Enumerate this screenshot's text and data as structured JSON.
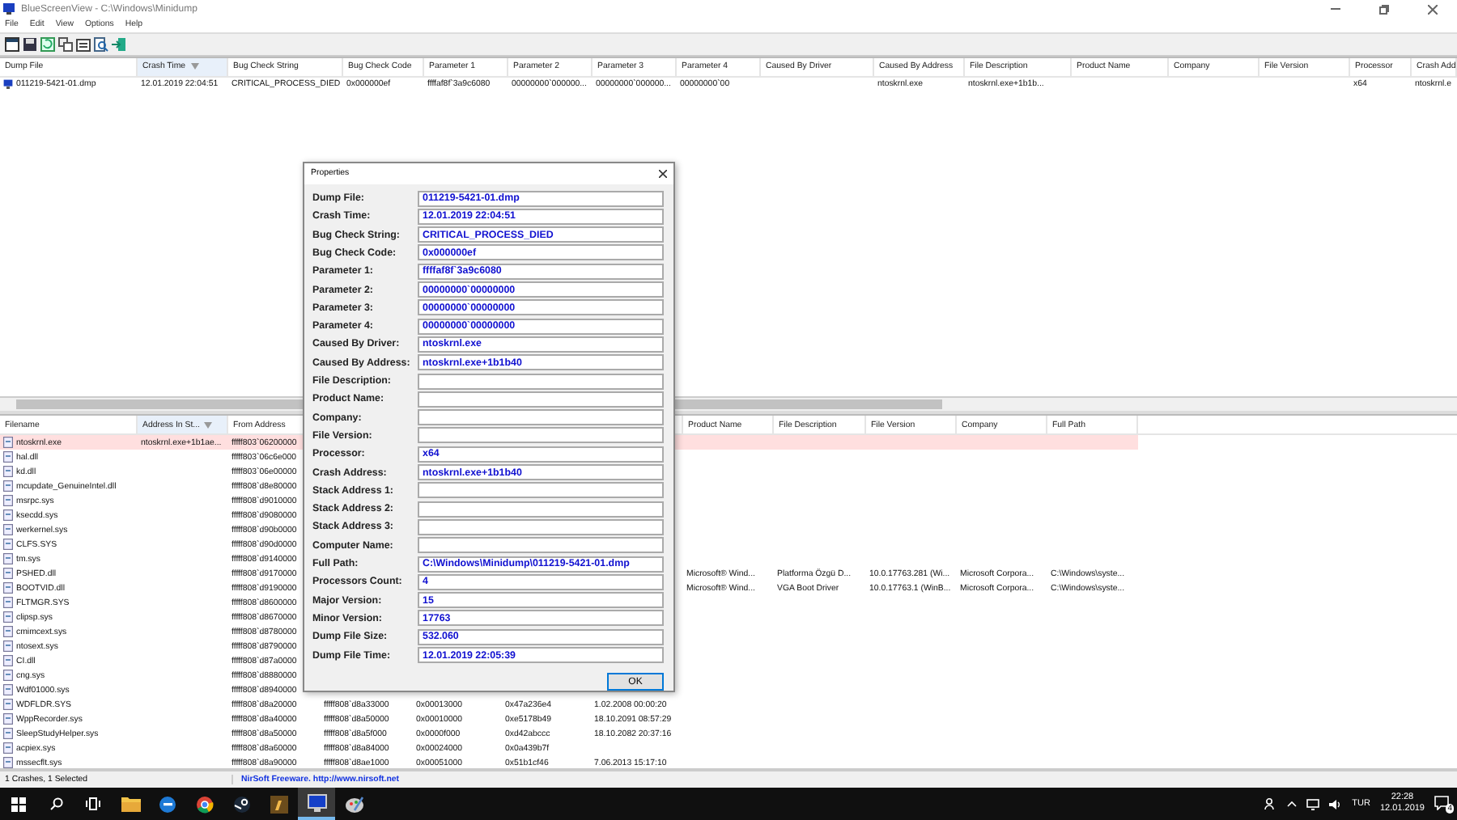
{
  "window": {
    "title": "BlueScreenView  -  C:\\Windows\\Minidump"
  },
  "menu": [
    "File",
    "Edit",
    "View",
    "Options",
    "Help"
  ],
  "dump_table": {
    "columns": [
      {
        "label": "Dump File",
        "sorted": false
      },
      {
        "label": "Crash Time",
        "sorted": true
      },
      {
        "label": "Bug Check String",
        "sorted": false
      },
      {
        "label": "Bug Check Code",
        "sorted": false
      },
      {
        "label": "Parameter 1",
        "sorted": false
      },
      {
        "label": "Parameter 2",
        "sorted": false
      },
      {
        "label": "Parameter 3",
        "sorted": false
      },
      {
        "label": "Parameter 4",
        "sorted": false
      },
      {
        "label": "Caused By Driver",
        "sorted": false
      },
      {
        "label": "Caused By Address",
        "sorted": false
      },
      {
        "label": "File Description",
        "sorted": false
      },
      {
        "label": "Product Name",
        "sorted": false
      },
      {
        "label": "Company",
        "sorted": false
      },
      {
        "label": "File Version",
        "sorted": false
      },
      {
        "label": "Processor",
        "sorted": false
      },
      {
        "label": "Crash Add",
        "sorted": false
      }
    ],
    "rows": [
      {
        "cells": [
          "011219-5421-01.dmp",
          "12.01.2019 22:04:51",
          "CRITICAL_PROCESS_DIED",
          "0x000000ef",
          "ffffaf8f`3a9c6080",
          "00000000`000000...",
          "00000000`000000...",
          "00000000`00",
          null,
          "ntoskrnl.exe",
          "ntoskrnl.exe+1b1b...",
          null,
          null,
          null,
          "x64",
          "ntoskrnl.e"
        ]
      }
    ]
  },
  "driver_table": {
    "columns": [
      {
        "label": "Filename",
        "sorted": false
      },
      {
        "label": "Address In St...",
        "sorted": true
      },
      {
        "label": "From Address",
        "sorted": false
      },
      null,
      null,
      null,
      null,
      {
        "label": "Product Name",
        "sorted": false
      },
      {
        "label": "File Description",
        "sorted": false
      },
      {
        "label": "File Version",
        "sorted": false
      },
      {
        "label": "Company",
        "sorted": false
      },
      {
        "label": "Full Path",
        "sorted": false
      }
    ],
    "rows": [
      {
        "highlighted": true,
        "cells": [
          "ntoskrnl.exe",
          "ntoskrnl.exe+1b1ae...",
          "fffff803`06200000"
        ]
      },
      {
        "highlighted": false,
        "cells": [
          "hal.dll",
          null,
          "fffff803`06c6e000"
        ]
      },
      {
        "highlighted": false,
        "cells": [
          "kd.dll",
          null,
          "fffff803`06e00000"
        ]
      },
      {
        "highlighted": false,
        "cells": [
          "mcupdate_GenuineIntel.dll",
          null,
          "fffff808`d8e80000"
        ]
      },
      {
        "highlighted": false,
        "cells": [
          "msrpc.sys",
          null,
          "fffff808`d9010000"
        ]
      },
      {
        "highlighted": false,
        "cells": [
          "ksecdd.sys",
          null,
          "fffff808`d9080000"
        ]
      },
      {
        "highlighted": false,
        "cells": [
          "werkernel.sys",
          null,
          "fffff808`d90b0000"
        ]
      },
      {
        "highlighted": false,
        "cells": [
          "CLFS.SYS",
          null,
          "fffff808`d90d0000"
        ]
      },
      {
        "highlighted": false,
        "cells": [
          "tm.sys",
          null,
          "fffff808`d9140000"
        ]
      },
      {
        "highlighted": false,
        "cells": [
          "PSHED.dll",
          null,
          "fffff808`d9170000",
          null,
          null,
          null,
          null,
          "Microsoft® Wind...",
          "Platforma Özgü D...",
          "10.0.17763.281 (Wi...",
          "Microsoft Corpora...",
          "C:\\Windows\\syste..."
        ]
      },
      {
        "highlighted": false,
        "cells": [
          "BOOTVID.dll",
          null,
          "fffff808`d9190000",
          null,
          null,
          null,
          null,
          "Microsoft® Wind...",
          "VGA Boot Driver",
          "10.0.17763.1 (WinB...",
          "Microsoft Corpora...",
          "C:\\Windows\\syste..."
        ]
      },
      {
        "highlighted": false,
        "cells": [
          "FLTMGR.SYS",
          null,
          "fffff808`d8600000"
        ]
      },
      {
        "highlighted": false,
        "cells": [
          "clipsp.sys",
          null,
          "fffff808`d8670000"
        ]
      },
      {
        "highlighted": false,
        "cells": [
          "cmimcext.sys",
          null,
          "fffff808`d8780000"
        ]
      },
      {
        "highlighted": false,
        "cells": [
          "ntosext.sys",
          null,
          "fffff808`d8790000"
        ]
      },
      {
        "highlighted": false,
        "cells": [
          "CI.dll",
          null,
          "fffff808`d87a0000"
        ]
      },
      {
        "highlighted": false,
        "cells": [
          "cng.sys",
          null,
          "fffff808`d8880000"
        ]
      },
      {
        "highlighted": false,
        "cells": [
          "Wdf01000.sys",
          null,
          "fffff808`d8940000"
        ]
      },
      {
        "highlighted": false,
        "cells": [
          "WDFLDR.SYS",
          null,
          "fffff808`d8a20000",
          "fffff808`d8a33000",
          "0x00013000",
          "0x47a236e4",
          "1.02.2008 00:00:20"
        ]
      },
      {
        "highlighted": false,
        "cells": [
          "WppRecorder.sys",
          null,
          "fffff808`d8a40000",
          "fffff808`d8a50000",
          "0x00010000",
          "0xe5178b49",
          "18.10.2091 08:57:29"
        ]
      },
      {
        "highlighted": false,
        "cells": [
          "SleepStudyHelper.sys",
          null,
          "fffff808`d8a50000",
          "fffff808`d8a5f000",
          "0x0000f000",
          "0xd42abccc",
          "18.10.2082 20:37:16"
        ]
      },
      {
        "highlighted": false,
        "cells": [
          "acpiex.sys",
          null,
          "fffff808`d8a60000",
          "fffff808`d8a84000",
          "0x00024000",
          "0x0a439b7f",
          null
        ]
      },
      {
        "highlighted": false,
        "cells": [
          "mssecflt.sys",
          null,
          "fffff808`d8a90000",
          "fffff808`d8ae1000",
          "0x00051000",
          "0x51b1cf46",
          "7.06.2013 15:17:10"
        ]
      }
    ]
  },
  "status_bar": {
    "selection": "1 Crashes, 1 Selected",
    "link": "NirSoft Freeware.  http://www.nirsoft.net"
  },
  "dialog": {
    "title": "Properties",
    "fields": [
      {
        "label": "Dump File:",
        "value": "011219-5421-01.dmp"
      },
      {
        "label": "Crash Time:",
        "value": "12.01.2019 22:04:51"
      },
      {
        "label": "Bug Check String:",
        "value": "CRITICAL_PROCESS_DIED"
      },
      {
        "label": "Bug Check Code:",
        "value": "0x000000ef"
      },
      {
        "label": "Parameter 1:",
        "value": "ffffaf8f`3a9c6080"
      },
      {
        "label": "Parameter 2:",
        "value": "00000000`00000000"
      },
      {
        "label": "Parameter 3:",
        "value": "00000000`00000000"
      },
      {
        "label": "Parameter 4:",
        "value": "00000000`00000000"
      },
      {
        "label": "Caused By Driver:",
        "value": "ntoskrnl.exe"
      },
      {
        "label": "Caused By Address:",
        "value": "ntoskrnl.exe+1b1b40"
      },
      {
        "label": "File Description:"
      },
      {
        "label": "Product Name:"
      },
      {
        "label": "Company:"
      },
      {
        "label": "File Version:"
      },
      {
        "label": "Processor:",
        "value": "x64"
      },
      {
        "label": "Crash Address:",
        "value": "ntoskrnl.exe+1b1b40"
      },
      {
        "label": "Stack Address 1:"
      },
      {
        "label": "Stack Address 2:"
      },
      {
        "label": "Stack Address 3:"
      },
      {
        "label": "Computer Name:"
      },
      {
        "label": "Full Path:",
        "value": "C:\\Windows\\Minidump\\011219-5421-01.dmp"
      },
      {
        "label": "Processors Count:",
        "value": "4"
      },
      {
        "label": "Major Version:",
        "value": "15"
      },
      {
        "label": "Minor Version:",
        "value": "17763"
      },
      {
        "label": "Dump File Size:",
        "value": "532.060"
      },
      {
        "label": "Dump File Time:",
        "value": "12.01.2019 22:05:39"
      }
    ],
    "ok_button": "OK"
  },
  "taskbar": {
    "apps": [
      {
        "active": false
      },
      {
        "active": false
      },
      {
        "active": false
      },
      {
        "active": false
      },
      {
        "active": false
      },
      {
        "active": true
      },
      {
        "active": false
      }
    ],
    "language": "TUR",
    "time": "22:28",
    "date": "12.01.2019",
    "notification_count": "4"
  }
}
